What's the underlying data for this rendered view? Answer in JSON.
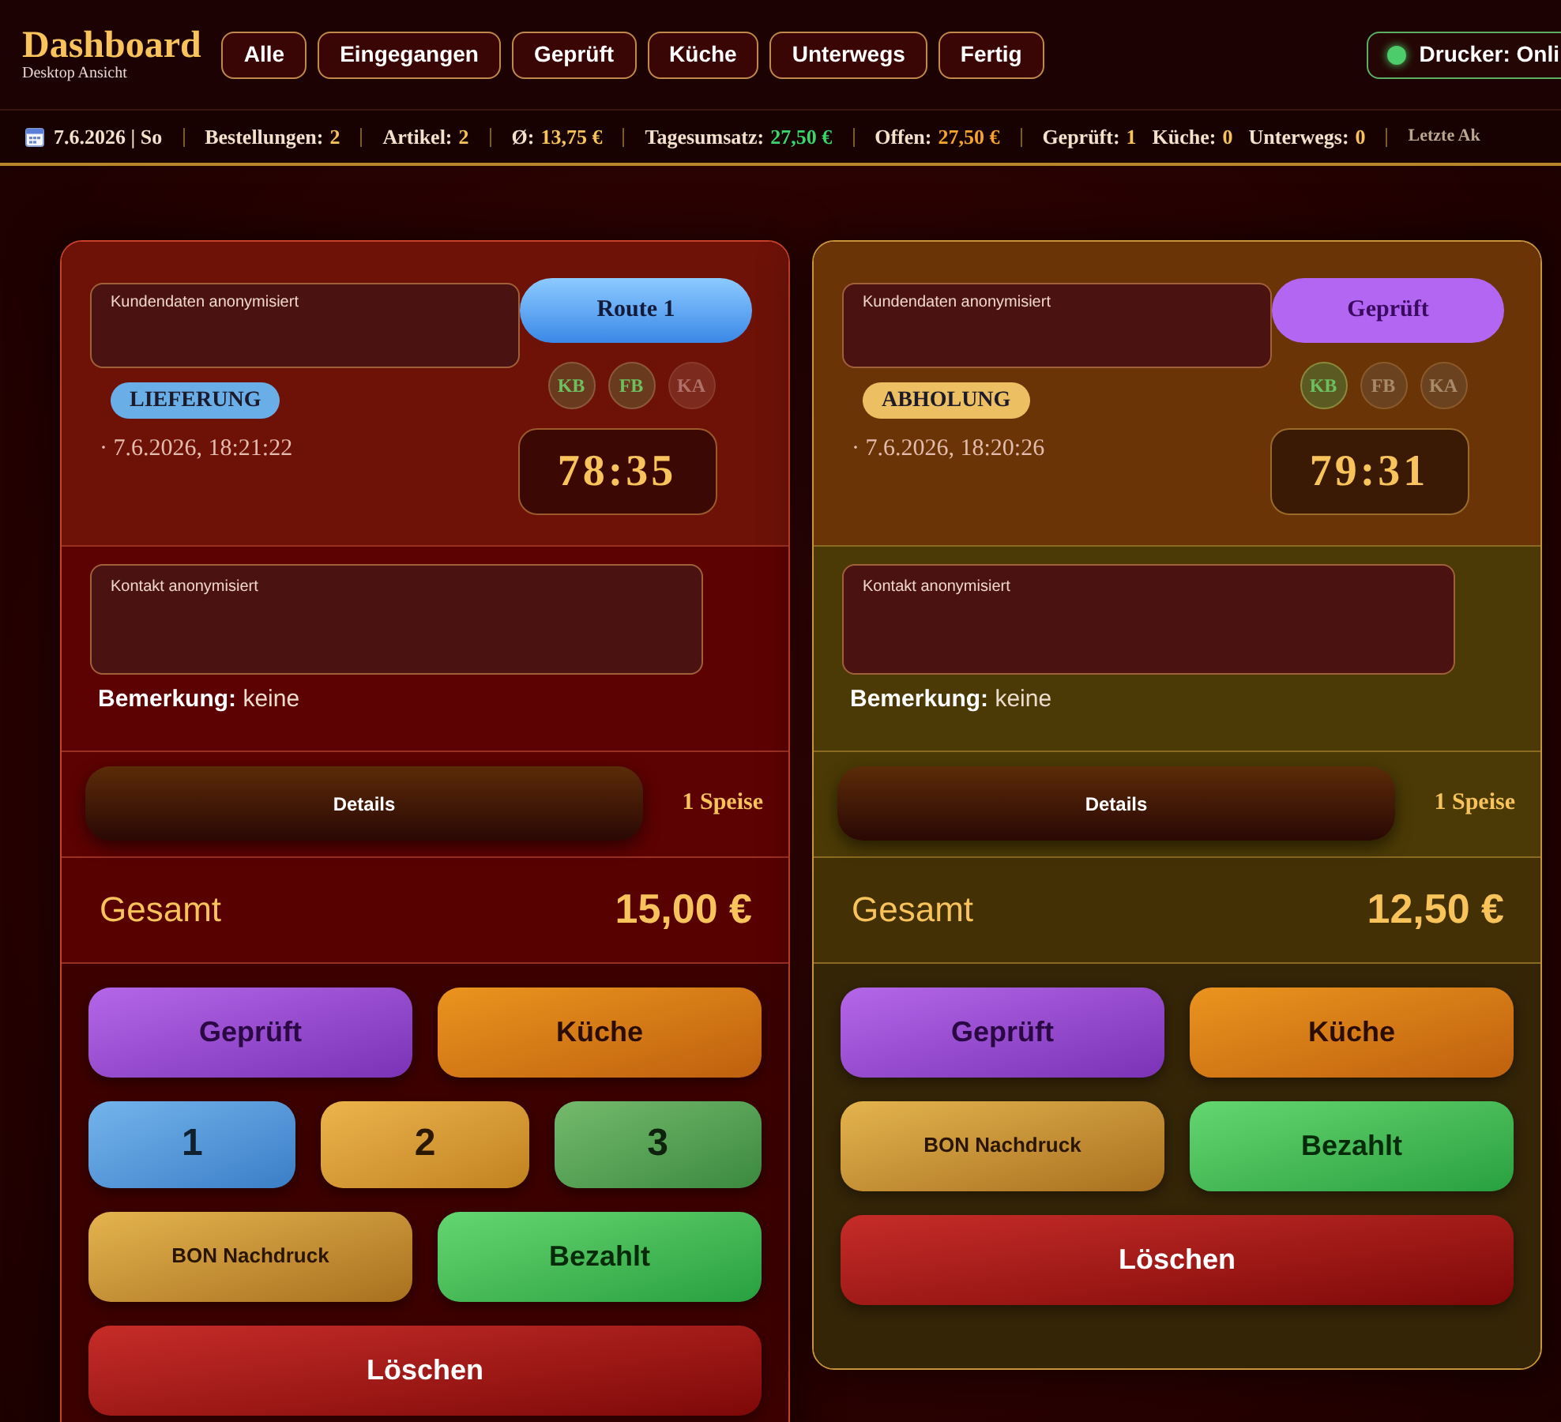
{
  "header": {
    "title": "Dashboard",
    "subtitle": "Desktop Ansicht",
    "filters": [
      "Alle",
      "Eingegangen",
      "Geprüft",
      "Küche",
      "Unterwegs",
      "Fertig"
    ],
    "printer": {
      "label": "Drucker: Onli",
      "online": true
    }
  },
  "stats_bar": {
    "date": "7.6.2026 | So",
    "groups": [
      [
        {
          "label": "Bestellungen:",
          "value": "2",
          "color": "#f7c35a"
        }
      ],
      [
        {
          "label": "Artikel:",
          "value": "2",
          "color": "#f7c35a"
        }
      ],
      [
        {
          "label": "Ø:",
          "value": "13,75 €",
          "color": "#f7c35a"
        }
      ],
      [
        {
          "label": "Tagesumsatz:",
          "value": "27,50 €",
          "color": "#3ad66a"
        }
      ],
      [
        {
          "label": "Offen:",
          "value": "27,50 €",
          "color": "#f5a52e"
        }
      ],
      [
        {
          "label": "Geprüft:",
          "value": "1",
          "color": "#f7c35a"
        },
        {
          "label": "Küche:",
          "value": "0",
          "color": "#f7c35a"
        },
        {
          "label": "Unterwegs:",
          "value": "0",
          "color": "#f7c35a"
        }
      ]
    ],
    "trailing": "Letzte Ak"
  },
  "orders": [
    {
      "status": {
        "label": "Route 1",
        "kind": "route"
      },
      "customer_field": "Kundendaten anonymisiert",
      "type": {
        "label": "LIEFERUNG",
        "color": "#6aaee8"
      },
      "created": "· 7.6.2026, 18:21:22",
      "flags": [
        {
          "label": "KB",
          "active": true
        },
        {
          "label": "FB",
          "active": true
        },
        {
          "label": "KA",
          "active": false
        }
      ],
      "timer": "78:35",
      "contact_field": "Kontakt anonymisiert",
      "remark": "**Bemerkung:** keine",
      "details_button": "Details",
      "item_count": "1 Speise",
      "total_label": "Gesamt",
      "total": "15,00 €",
      "action_rows": [
        [
          {
            "label": "Geprüft",
            "kind": "checked"
          },
          {
            "label": "Küche",
            "kind": "kitchen"
          }
        ],
        [
          {
            "label": "1",
            "kind": "route1"
          },
          {
            "label": "2",
            "kind": "route2"
          },
          {
            "label": "3",
            "kind": "route3"
          }
        ],
        [
          {
            "label": "BON Nachdruck",
            "kind": "reprint"
          },
          {
            "label": "Bezahlt",
            "kind": "paid"
          }
        ],
        [
          {
            "label": "Löschen",
            "kind": "delete"
          }
        ]
      ]
    },
    {
      "status": {
        "label": "Geprüft",
        "kind": "checked"
      },
      "customer_field": "Kundendaten anonymisiert",
      "type": {
        "label": "ABHOLUNG",
        "color": "#ecc062"
      },
      "created": "· 7.6.2026, 18:20:26",
      "flags": [
        {
          "label": "KB",
          "active": true
        },
        {
          "label": "FB",
          "active": false
        },
        {
          "label": "KA",
          "active": false
        }
      ],
      "timer": "79:31",
      "contact_field": "Kontakt anonymisiert",
      "remark": "**Bemerkung:** keine",
      "details_button": "Details",
      "item_count": "1 Speise",
      "total_label": "Gesamt",
      "total": "12,50 €",
      "action_rows": [
        [
          {
            "label": "Geprüft",
            "kind": "checked"
          },
          {
            "label": "Küche",
            "kind": "kitchen"
          }
        ],
        [
          {
            "label": "BON Nachdruck",
            "kind": "reprint"
          },
          {
            "label": "Bezahlt",
            "kind": "paid"
          }
        ],
        [
          {
            "label": "Löschen",
            "kind": "delete"
          }
        ]
      ]
    }
  ]
}
